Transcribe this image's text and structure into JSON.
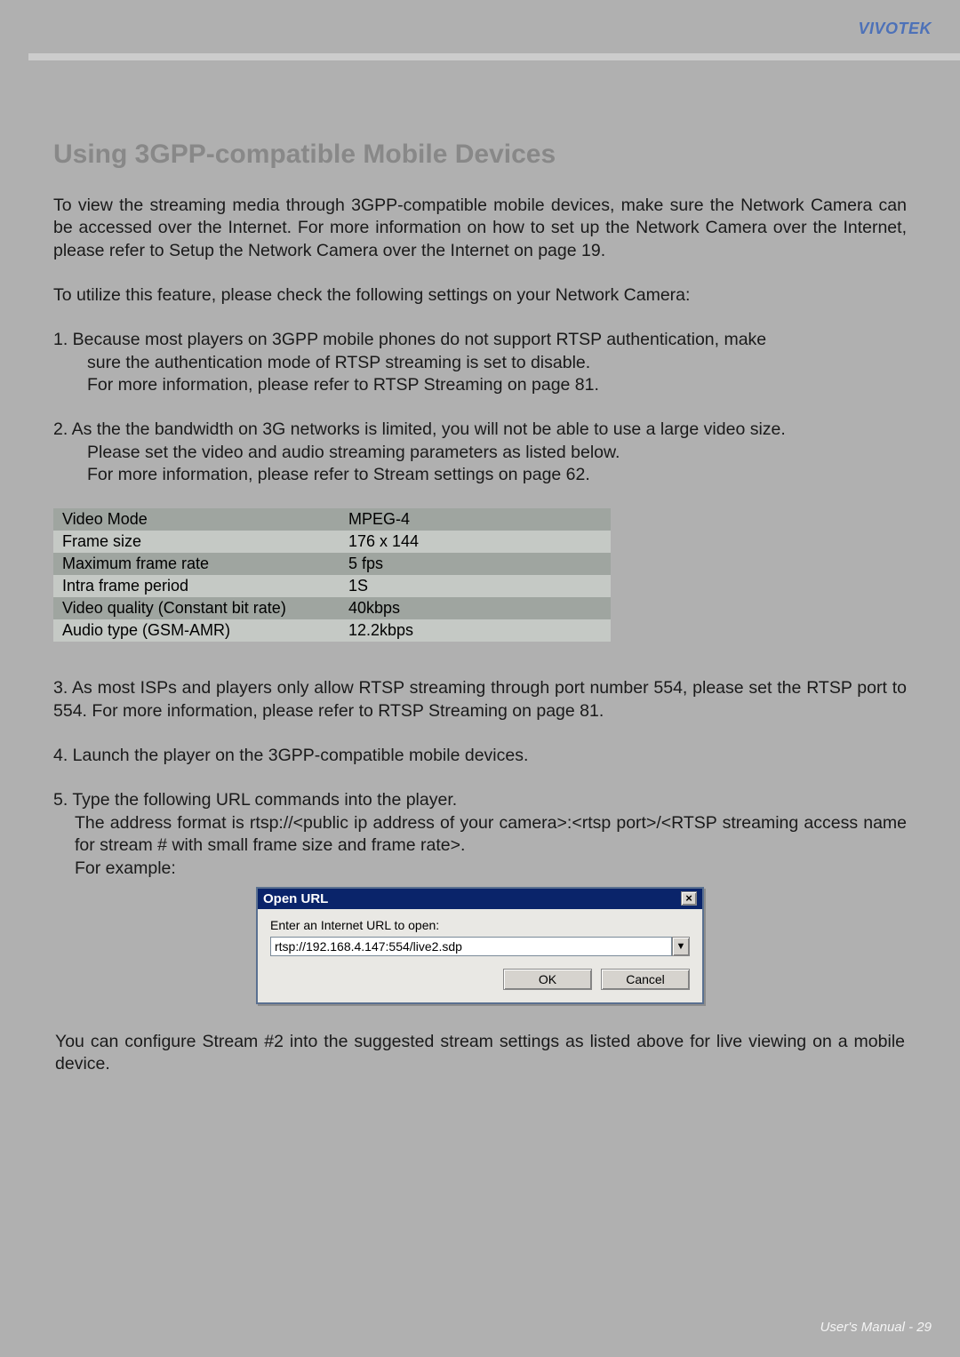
{
  "header": {
    "brand": "VIVOTEK"
  },
  "title": "Using 3GPP-compatible Mobile Devices",
  "para1": "To view the streaming media through 3GPP-compatible mobile devices, make sure the Network Camera can be accessed over the Internet. For more information on how to set up the Network Camera over the Internet, please refer to Setup the Network Camera over the Internet on page 19.",
  "para2": "To utilize this feature, please check the following settings on your Network Camera:",
  "item1": {
    "line1": "1. Because most players on 3GPP mobile phones do not support RTSP authentication, make",
    "line2": "sure the authentication mode of RTSP streaming is set to disable.",
    "line3": "For more information, please refer to RTSP Streaming on page 81."
  },
  "item2": {
    "line1": "2. As the the bandwidth on 3G networks is limited, you will not be able to use a large video size.",
    "line2": "Please set the video and audio streaming parameters as listed below.",
    "line3": "For more information, please refer to Stream settings on page 62."
  },
  "table": {
    "rows": [
      {
        "label": "Video Mode",
        "value": "MPEG-4"
      },
      {
        "label": "Frame size",
        "value": "176 x 144"
      },
      {
        "label": "Maximum frame rate",
        "value": "5 fps"
      },
      {
        "label": "Intra frame period",
        "value": "1S"
      },
      {
        "label": "Video quality (Constant bit rate)",
        "value": "40kbps"
      },
      {
        "label": "Audio type (GSM-AMR)",
        "value": "12.2kbps"
      }
    ]
  },
  "item3": "3. As most ISPs and players only allow RTSP streaming through port number 554, please set the RTSP port to 554. For more information, please refer to RTSP Streaming on page 81.",
  "item4": "4. Launch the player on the 3GPP-compatible mobile devices.",
  "item5": {
    "line1": "5. Type the following URL commands into the player.",
    "line2": "The address format is rtsp://<public ip address of your camera>:<rtsp port>/<RTSP streaming access name for stream # with small frame size and frame rate>.",
    "line3": "For example:"
  },
  "dialog": {
    "title": "Open URL",
    "close": "×",
    "label": "Enter an Internet URL to open:",
    "value": "rtsp://192.168.4.147:554/live2.sdp",
    "ok": "OK",
    "cancel": "Cancel",
    "arrow": "▼"
  },
  "footnote": "You can configure Stream #2 into the suggested stream settings as listed above for live viewing on a mobile device.",
  "footer": "User's Manual - 29"
}
